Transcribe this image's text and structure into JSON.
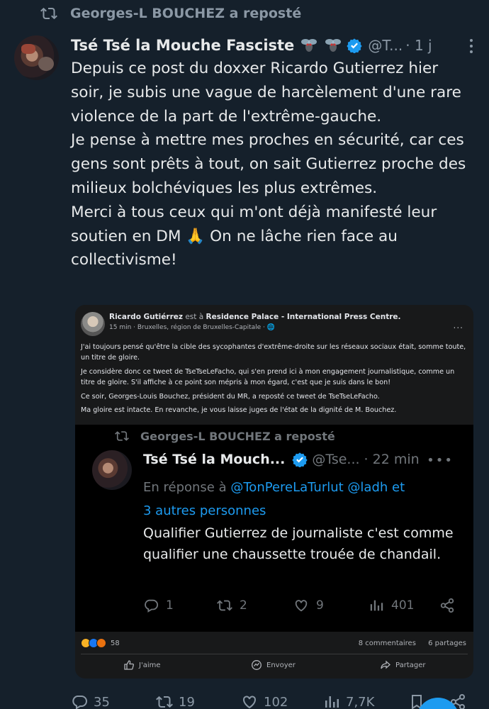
{
  "repost": {
    "text": "Georges-L BOUCHEZ a reposté"
  },
  "tweet": {
    "author_name": "Tsé Tsé la Mouche Fasciste",
    "handle": "@T...",
    "time": "· 1 j",
    "paragraphs": [
      "Depuis ce post du doxxer Ricardo Gutierrez hier soir, je subis une vague de harcèlement d'une rare violence de la part de l'extrême-gauche.",
      "Je pense à mettre mes proches en sécurité, car ces gens sont prêts à tout, on sait Gutierrez proche des milieux bolchéviques les plus extrêmes.",
      "Merci à tous ceux qui m'ont déjà manifesté leur soutien en DM 🙏 On ne lâche rien face au collectivisme!"
    ],
    "stats": {
      "replies": "35",
      "reposts": "19",
      "likes": "102",
      "views": "7,7K"
    }
  },
  "embedded": {
    "fb_author": "Ricardo Gutiérrez",
    "fb_at": "est à",
    "fb_place": "Residence Palace - International Press Centre.",
    "fb_meta": "15 min · Bruxelles, région de Bruxelles-Capitale · 🌐",
    "fb_dots": "...",
    "fb_paragraphs": [
      "J'ai toujours pensé qu'être la cible des sycophantes d'extrême-droite sur les réseaux sociaux était, somme toute, un titre de gloire.",
      "Je considère donc ce tweet de TseTseLeFacho, qui s'en prend ici à mon engagement journalistique, comme un titre de gloire. S'il affiche à ce point son mépris à mon égard, c'est que je suis dans le bon!",
      "Ce soir, Georges-Louis Bouchez, président du MR, a reposté ce tweet de TseTseLeFacho.",
      "Ma gloire est intacte. En revanche, je vous laisse juges de l'état de la dignité de M. Bouchez."
    ],
    "nested": {
      "repost": "Georges-L BOUCHEZ a reposté",
      "author_name": "Tsé Tsé la Mouch...",
      "handle": "@Tse...",
      "time": "· 22 min",
      "dots": "•••",
      "reply_prefix": "En réponse à",
      "reply_links": "@TonPereLaTurlut @ladh",
      "reply_suffix": "et",
      "reply_more": "3 autres personnes",
      "text": "Qualifier Gutierrez de journaliste c'est comme qualifier une chaussette trouée de chandail.",
      "stats": {
        "replies": "1",
        "reposts": "2",
        "likes": "9",
        "views": "401"
      }
    },
    "reactions_count": "58",
    "comments": "8 commentaires",
    "shares": "6 partages",
    "buttons": {
      "like": "J'aime",
      "send": "Envoyer",
      "share": "Partager"
    }
  },
  "colors": {
    "background": "#15202b",
    "accent": "#1d9bf0",
    "muted": "#8b98a5"
  }
}
